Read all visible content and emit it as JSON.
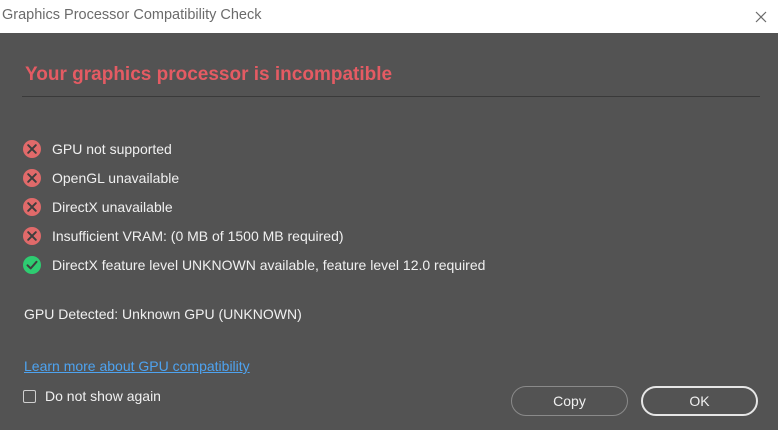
{
  "window": {
    "title": "Graphics Processor Compatibility Check"
  },
  "main": {
    "headline": "Your graphics processor is incompatible",
    "checks": [
      {
        "status": "fail",
        "icon": "error-x-icon",
        "text": "GPU not supported"
      },
      {
        "status": "fail",
        "icon": "error-x-icon",
        "text": "OpenGL unavailable"
      },
      {
        "status": "fail",
        "icon": "error-x-icon",
        "text": "DirectX unavailable"
      },
      {
        "status": "fail",
        "icon": "error-x-icon",
        "text": "Insufficient VRAM: (0 MB of 1500 MB required)"
      },
      {
        "status": "pass",
        "icon": "success-check-icon",
        "text": "DirectX feature level UNKNOWN available, feature level 12.0 required"
      }
    ],
    "gpu_detected": "GPU Detected: Unknown GPU (UNKNOWN)"
  },
  "footer": {
    "learn_more_link": "Learn more about GPU compatibility",
    "dont_show_again": {
      "label": "Do not show again",
      "checked": false
    },
    "copy_button": "Copy",
    "ok_button": "OK"
  },
  "colors": {
    "background": "#535353",
    "headline": "#e45b63",
    "error": "#e16a6a",
    "success": "#2ecc71",
    "link": "#4ea3f0"
  }
}
